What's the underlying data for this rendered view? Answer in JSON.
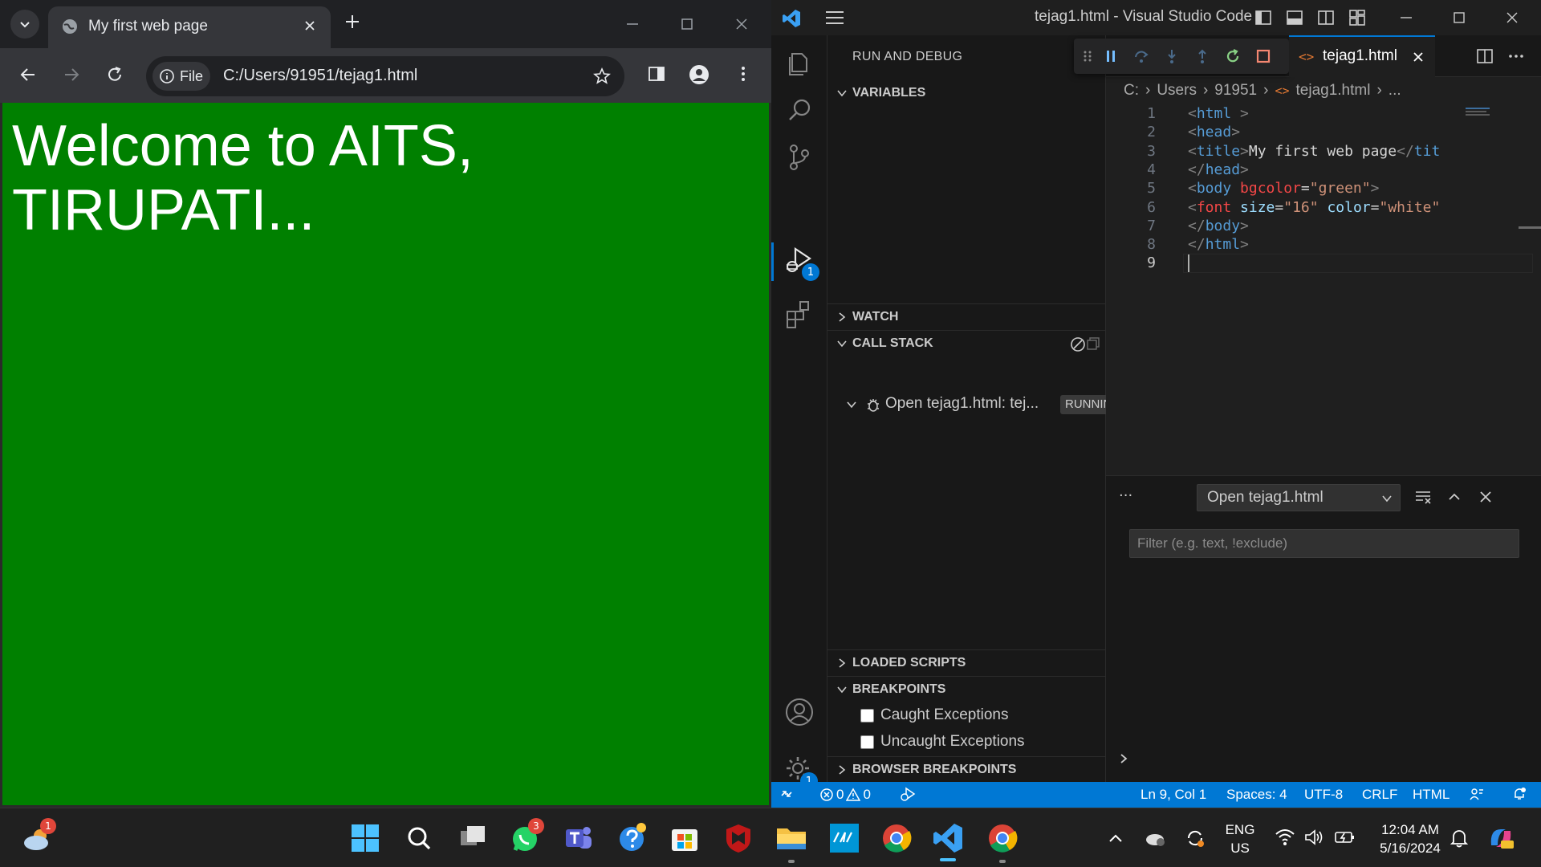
{
  "chrome": {
    "tab_title": "My first web page",
    "chip_label": "File",
    "url": "C:/Users/91951/tejag1.html",
    "content_bg": "#008000",
    "heading": "Welcome to AITS, TIRUPATI..."
  },
  "vscode": {
    "window_title": "tejag1.html - Visual Studio Code",
    "activity_badges": {
      "run_debug": "1",
      "manage": "1"
    },
    "sidebar": {
      "title": "RUN AND DEBUG",
      "sections": {
        "variables": "VARIABLES",
        "watch": "WATCH",
        "call_stack": "CALL STACK",
        "loaded_scripts": "LOADED SCRIPTS",
        "breakpoints": "BREAKPOINTS",
        "browser_breakpoints": "BROWSER BREAKPOINTS"
      },
      "call_stack_item": {
        "label": "Open tejag1.html: tej...",
        "status": "RUNNING"
      },
      "breakpoint_items": [
        "Caught Exceptions",
        "Uncaught Exceptions"
      ]
    },
    "editor": {
      "tab_label": "tejag1.html",
      "tab_icon": "<>",
      "breadcrumb": [
        "C:",
        "Users",
        "91951",
        "tejag1.html",
        "..."
      ],
      "lines": [
        {
          "n": "1",
          "tokens": [
            [
              "b",
              "<"
            ],
            [
              "t",
              "html"
            ],
            [
              "b",
              " >"
            ]
          ]
        },
        {
          "n": "2",
          "tokens": [
            [
              "b",
              "<"
            ],
            [
              "t",
              "head"
            ],
            [
              "b",
              ">"
            ]
          ]
        },
        {
          "n": "3",
          "tokens": [
            [
              "b",
              "<"
            ],
            [
              "t",
              "title"
            ],
            [
              "b",
              ">"
            ],
            [
              "x",
              "My first web page"
            ],
            [
              "b",
              "</"
            ],
            [
              "t",
              "tit"
            ]
          ]
        },
        {
          "n": "4",
          "tokens": [
            [
              "b",
              "</"
            ],
            [
              "t",
              "head"
            ],
            [
              "b",
              ">"
            ]
          ]
        },
        {
          "n": "5",
          "tokens": [
            [
              "b",
              "<"
            ],
            [
              "t",
              "body"
            ],
            [
              "x",
              " "
            ],
            [
              "r",
              "bgcolor"
            ],
            [
              "x",
              "="
            ],
            [
              "s",
              "\"green\""
            ],
            [
              "b",
              ">"
            ]
          ]
        },
        {
          "n": "6",
          "tokens": [
            [
              "b",
              "<"
            ],
            [
              "r",
              "font"
            ],
            [
              "x",
              " "
            ],
            [
              "a",
              "size"
            ],
            [
              "x",
              "="
            ],
            [
              "s",
              "\"16\""
            ],
            [
              "x",
              " "
            ],
            [
              "a",
              "color"
            ],
            [
              "x",
              "="
            ],
            [
              "s",
              "\"white\""
            ]
          ]
        },
        {
          "n": "7",
          "tokens": [
            [
              "b",
              "</"
            ],
            [
              "t",
              "body"
            ],
            [
              "b",
              ">"
            ]
          ]
        },
        {
          "n": "8",
          "tokens": [
            [
              "b",
              "</"
            ],
            [
              "t",
              "html"
            ],
            [
              "b",
              ">"
            ]
          ]
        },
        {
          "n": "9",
          "tokens": []
        }
      ]
    },
    "panel": {
      "select_value": "Open tejag1.html",
      "filter_placeholder": "Filter (e.g. text, !exclude)"
    },
    "statusbar": {
      "errors": "0",
      "warnings": "0",
      "position": "Ln 9, Col 1",
      "spaces": "Spaces: 4",
      "encoding": "UTF-8",
      "eol": "CRLF",
      "language": "HTML"
    }
  },
  "taskbar": {
    "weather_badge": "1",
    "whatsapp_badge": "3",
    "lang_line1": "ENG",
    "lang_line2": "US",
    "time": "12:04 AM",
    "date": "5/16/2024"
  }
}
